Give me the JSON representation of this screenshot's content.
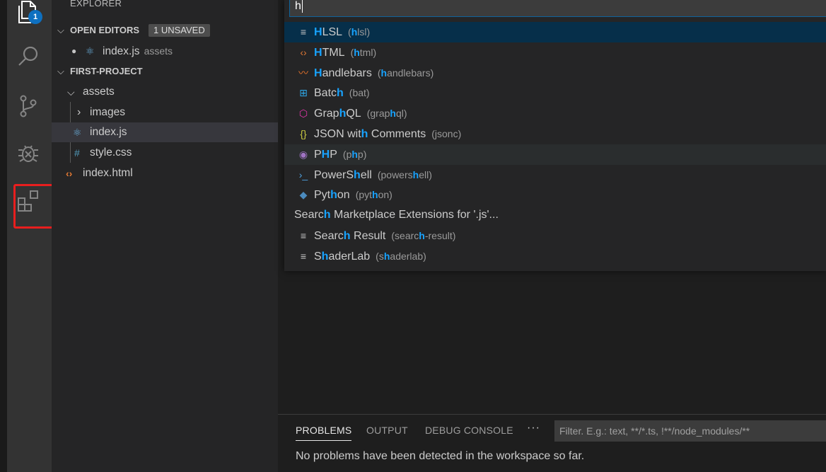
{
  "activity_bar": {
    "explorer_badge": "1",
    "icons": [
      "files-icon",
      "search-icon",
      "source-control-icon",
      "debug-icon",
      "extensions-icon"
    ]
  },
  "sidebar": {
    "title": "EXPLORER",
    "open_editors": {
      "label": "OPEN EDITORS",
      "badge": "1 UNSAVED",
      "items": [
        {
          "name": "index.js",
          "desc": "assets"
        }
      ]
    },
    "project": {
      "label": "FIRST-PROJECT",
      "tree": [
        {
          "name": "assets",
          "type": "folder-open"
        },
        {
          "name": "images",
          "type": "folder-closed"
        },
        {
          "name": "index.js",
          "type": "js"
        },
        {
          "name": "style.css",
          "type": "css"
        },
        {
          "name": "index.html",
          "type": "html"
        }
      ]
    }
  },
  "quick_pick": {
    "input_value": "h",
    "items": [
      {
        "pre": "",
        "hl": "H",
        "post": "LSL",
        "dpre": "(",
        "dhl": "h",
        "dpost": "lsl)",
        "icon": "≡",
        "icon_color": "#c5c5c5",
        "icon_name": "file-lines-icon"
      },
      {
        "pre": "",
        "hl": "H",
        "post": "TML",
        "dpre": "(",
        "dhl": "h",
        "dpost": "tml)",
        "icon": "‹›",
        "icon_color": "#e37933",
        "icon_name": "html-icon"
      },
      {
        "pre": "",
        "hl": "H",
        "post": "andlebars",
        "dpre": "(",
        "dhl": "h",
        "dpost": "andlebars)",
        "icon": "〰",
        "icon_color": "#f0772b",
        "icon_name": "handlebars-icon"
      },
      {
        "pre": "Batc",
        "hl": "h",
        "post": "",
        "dpre": "(bat)",
        "dhl": "",
        "dpost": "",
        "icon": "⊞",
        "icon_color": "#2ea8e8",
        "icon_name": "windows-icon"
      },
      {
        "pre": "Grap",
        "hl": "h",
        "post": "QL",
        "dpre": "(grap",
        "dhl": "h",
        "dpost": "ql)",
        "icon": "⬡",
        "icon_color": "#e535ab",
        "icon_name": "graphql-icon"
      },
      {
        "pre": "JSON wit",
        "hl": "h",
        "post": " Comments",
        "dpre": "(jsonc)",
        "dhl": "",
        "dpost": "",
        "icon": "{}",
        "icon_color": "#cbcb41",
        "icon_name": "json-icon"
      },
      {
        "pre": "P",
        "hl": "H",
        "post": "P",
        "dpre": "(p",
        "dhl": "h",
        "dpost": "p)",
        "icon": "◉",
        "icon_color": "#a074c4",
        "icon_name": "php-icon"
      },
      {
        "pre": "PowerS",
        "hl": "h",
        "post": "ell",
        "dpre": "(powers",
        "dhl": "h",
        "dpost": "ell)",
        "icon": "›_",
        "icon_color": "#4fa3e0",
        "icon_name": "powershell-icon"
      },
      {
        "pre": "Pyt",
        "hl": "h",
        "post": "on",
        "dpre": "(pyt",
        "dhl": "h",
        "dpost": "on)",
        "icon": "◆",
        "icon_color": "#4b8bbe",
        "icon_name": "python-icon"
      },
      {
        "pre": "Searc",
        "hl": "h",
        "post": " Marketplace Extensions for '.js'...",
        "dpre": "",
        "dhl": "",
        "dpost": "",
        "icon": "",
        "icon_color": "#c5c5c5",
        "icon_name": ""
      },
      {
        "pre": "Searc",
        "hl": "h",
        "post": " Result",
        "dpre": "(searc",
        "dhl": "h",
        "dpost": "-result)",
        "icon": "≡",
        "icon_color": "#c5c5c5",
        "icon_name": "file-lines-icon"
      },
      {
        "pre": "S",
        "hl": "h",
        "post": "aderLab",
        "dpre": "(s",
        "dhl": "h",
        "dpost": "aderlab)",
        "icon": "≡",
        "icon_color": "#c5c5c5",
        "icon_name": "file-lines-icon"
      }
    ]
  },
  "panel": {
    "tabs": [
      "PROBLEMS",
      "OUTPUT",
      "DEBUG CONSOLE"
    ],
    "more": "···",
    "filter_placeholder": "Filter. E.g.: text, **/*.ts, !**/node_modules/**",
    "message": "No problems have been detected in the workspace so far."
  },
  "colors": {
    "accent": "#0e70c0",
    "highlight_match": "#18a3ff",
    "selection_box": "#e81e1e"
  }
}
